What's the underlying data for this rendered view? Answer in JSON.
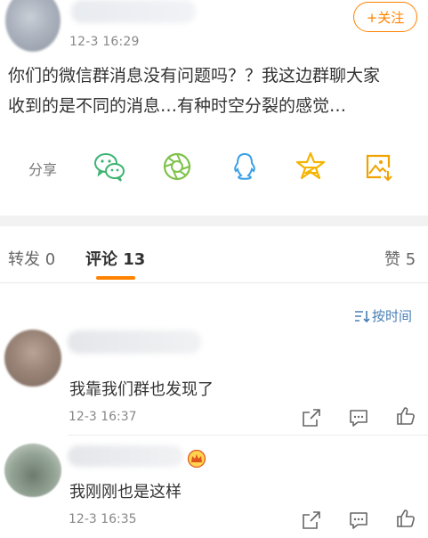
{
  "post": {
    "time": "12-3 16:29",
    "follow_label": "+关注",
    "text": "你们的微信群消息没有问题吗？？我这边群聊大家\n收到的是不同的消息…有种时空分裂的感觉…"
  },
  "share": {
    "label": "分享",
    "icons": [
      "wechat-icon",
      "moments-icon",
      "qq-icon",
      "qzone-star-icon",
      "save-image-icon"
    ]
  },
  "tabs": {
    "repost": "转发 0",
    "comment": "评论 13",
    "like": "赞 5"
  },
  "sort": {
    "label": "按时间"
  },
  "comments": [
    {
      "text": "我靠我们群也发现了",
      "time": "12-3 16:37"
    },
    {
      "text": "我刚刚也是这样",
      "time": "12-3 16:35"
    }
  ],
  "colors": {
    "accent": "#ff8200",
    "link": "#4a7fb5",
    "wechat": "#3cb371",
    "moments": "#7ec24a",
    "qq": "#3aa0e6",
    "qzone": "#f5b400",
    "save": "#f0a300"
  }
}
